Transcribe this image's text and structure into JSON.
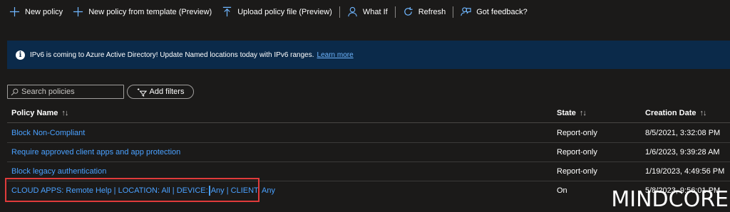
{
  "toolbar": {
    "new_policy": "New policy",
    "new_from_template": "New policy from template (Preview)",
    "upload": "Upload policy file (Preview)",
    "what_if": "What If",
    "refresh": "Refresh",
    "feedback": "Got feedback?"
  },
  "banner": {
    "text": "IPv6 is coming to Azure Active Directory! Update Named locations today with IPv6 ranges.",
    "link": "Learn more"
  },
  "search": {
    "placeholder": "Search policies"
  },
  "filters": {
    "label": "Add filters"
  },
  "table": {
    "columns": {
      "name": "Policy Name",
      "state": "State",
      "date": "Creation Date"
    },
    "rows": [
      {
        "name": "Block Non-Compliant",
        "state": "Report-only",
        "date": "8/5/2021, 3:32:08 PM"
      },
      {
        "name": "Require approved client apps and app protection",
        "state": "Report-only",
        "date": "1/6/2023, 9:39:28 AM"
      },
      {
        "name": "Block legacy authentication",
        "state": "Report-only",
        "date": "1/19/2023, 4:49:56 PM"
      },
      {
        "name_before_cursor": "CLOUD APPS: Remote Help | LOCATION: All | DEVICE:",
        "name_after_cursor": "Any | CLIENT: Any",
        "state": "On",
        "date": "5/8/2023, 9:56:01 PM"
      }
    ]
  },
  "watermark": "MINDCORE",
  "colors": {
    "link": "#4aa1ff",
    "banner_bg": "#0b2a4a",
    "highlight": "#e03b3b",
    "background": "#1b1a19"
  },
  "icons": [
    "plus-icon",
    "upload-icon",
    "person-icon",
    "refresh-icon",
    "feedback-icon",
    "info-icon",
    "search-icon",
    "filter-icon",
    "sort-icon"
  ]
}
